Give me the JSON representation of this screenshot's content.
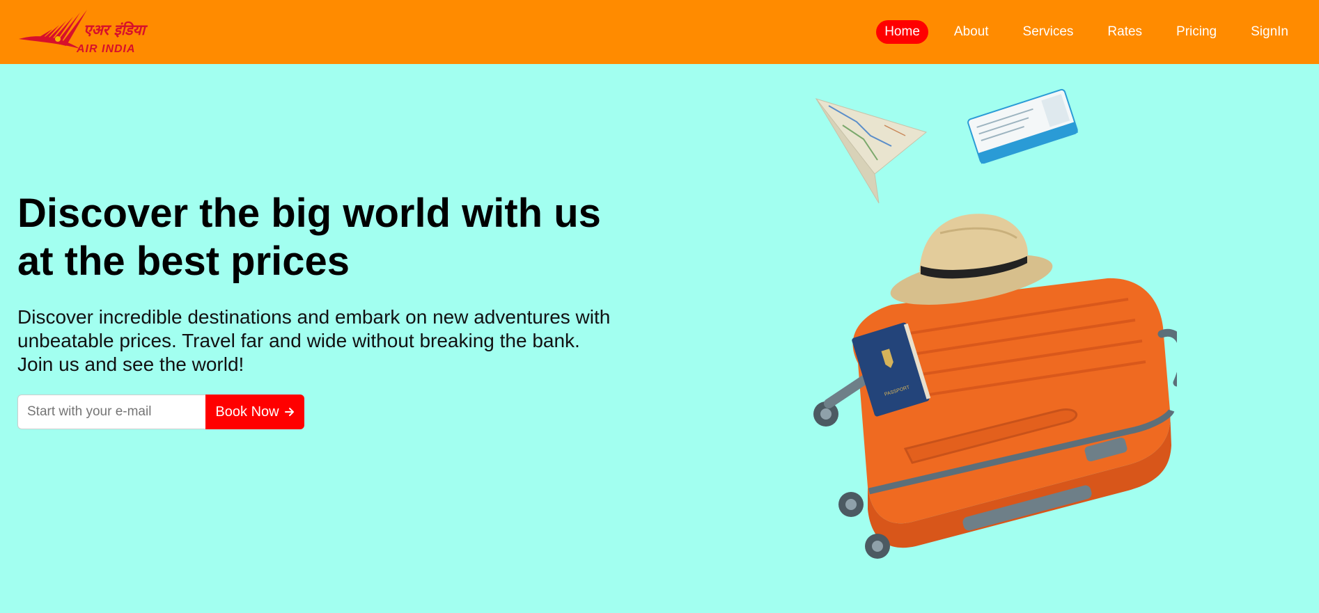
{
  "brand": {
    "name_hindi": "एअर इंडिया",
    "name": "AIR INDIA"
  },
  "nav": {
    "items": [
      {
        "label": "Home",
        "active": true
      },
      {
        "label": "About",
        "active": false
      },
      {
        "label": "Services",
        "active": false
      },
      {
        "label": "Rates",
        "active": false
      },
      {
        "label": "Pricing",
        "active": false
      },
      {
        "label": "SignIn",
        "active": false
      }
    ]
  },
  "hero": {
    "title_line1": "Discover the big world with us",
    "title_line2": "at the best prices",
    "description_line1": "Discover incredible destinations and embark on new adventures with",
    "description_line2": "unbeatable prices. Travel far and wide without breaking the bank.",
    "description_line3": "Join us and see the world!",
    "email_placeholder": "Start with your e-mail",
    "book_label": "Book Now",
    "book_icon": "arrow-right-icon",
    "passport_label": "PASSPORT"
  },
  "colors": {
    "navbar": "#ff8b00",
    "background": "#a2fff0",
    "accent": "#ff0000",
    "logo_red": "#d7102b"
  }
}
